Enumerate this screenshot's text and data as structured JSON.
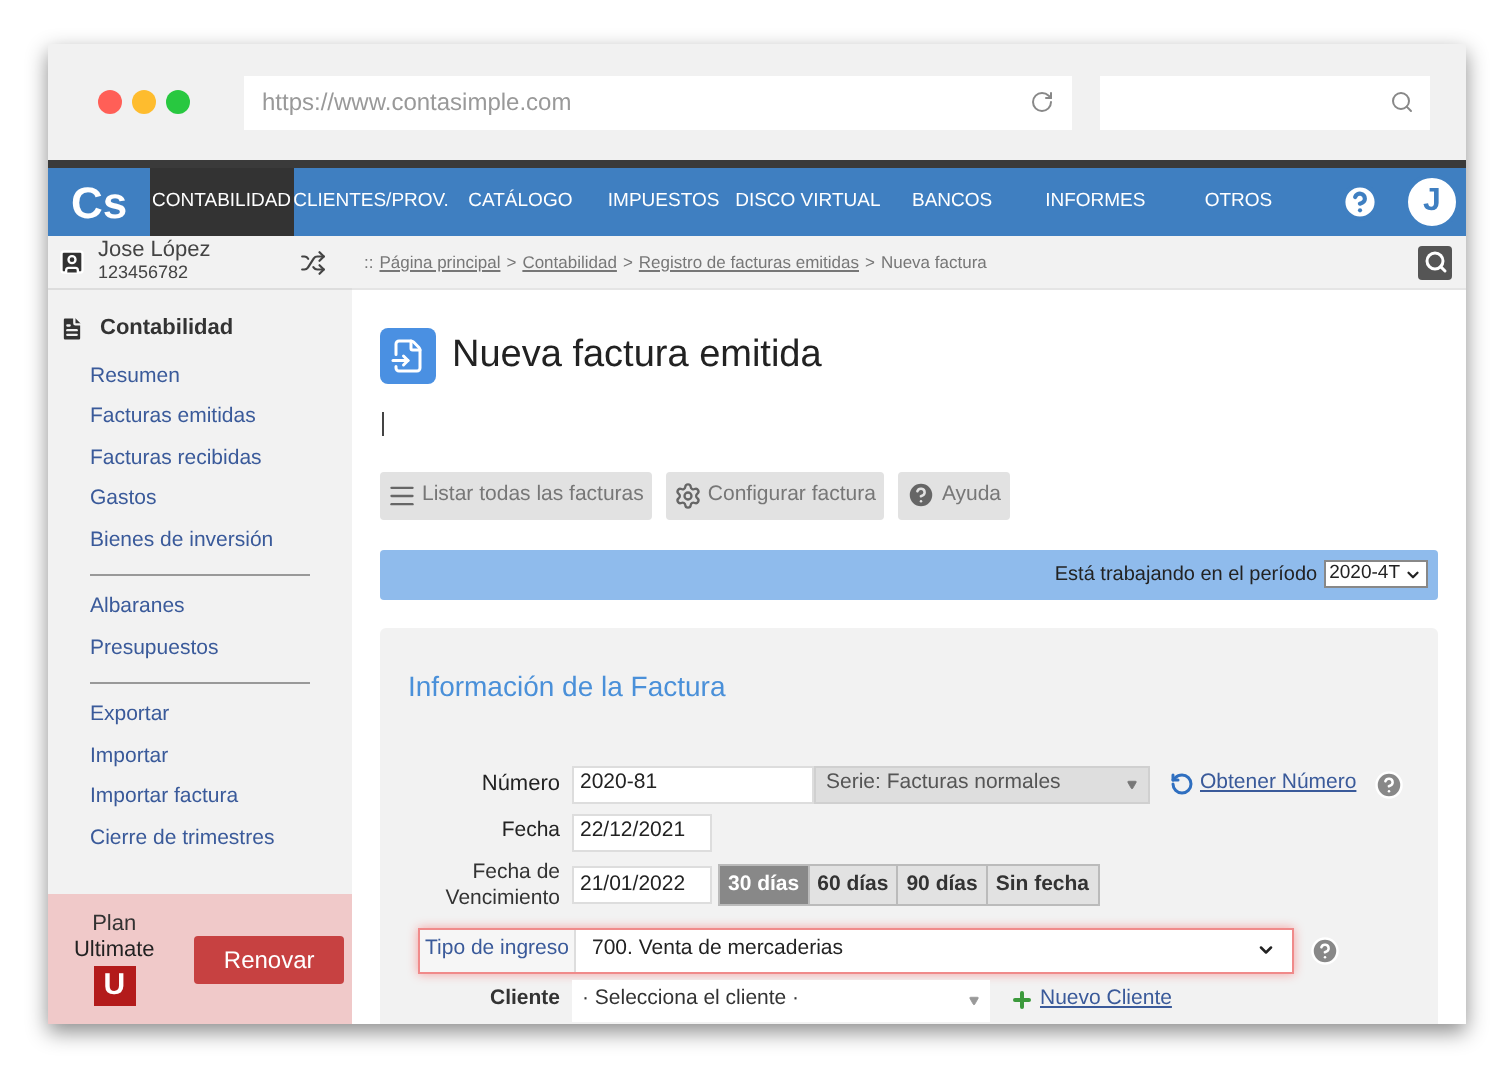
{
  "browser": {
    "url": "https://www.contasimple.com"
  },
  "nav": {
    "logo": "Cs",
    "tabs": [
      {
        "label": "CONTABILIDAD",
        "selected": true
      },
      {
        "label": "CLIENTES/PROV.",
        "selected": false
      },
      {
        "label": "CATÁLOGO",
        "selected": false
      },
      {
        "label": "IMPUESTOS",
        "selected": false
      },
      {
        "label": "DISCO VIRTUAL",
        "selected": false
      },
      {
        "label": "BANCOS",
        "selected": false
      },
      {
        "label": "INFORMES",
        "selected": false
      },
      {
        "label": "OTROS",
        "selected": false
      }
    ],
    "avatar": "J"
  },
  "user": {
    "name": "Jose López",
    "id": "123456782"
  },
  "breadcrumb": [
    {
      "kind": "sep",
      "text": "::"
    },
    {
      "kind": "link",
      "text": "Página principal"
    },
    {
      "kind": "sep",
      "text": ">"
    },
    {
      "kind": "link",
      "text": "Contabilidad"
    },
    {
      "kind": "sep",
      "text": ">"
    },
    {
      "kind": "link",
      "text": "Registro de facturas emitidas"
    },
    {
      "kind": "sep",
      "text": ">"
    },
    {
      "kind": "current",
      "text": "Nueva factura"
    }
  ],
  "sidebar": {
    "title": "Contabilidad",
    "groups": [
      [
        "Resumen",
        "Facturas emitidas",
        "Facturas recibidas",
        "Gastos",
        "Bienes de inversión"
      ],
      [
        "Albaranes",
        "Presupuestos"
      ],
      [
        "Exportar",
        "Importar",
        "Importar factura",
        "Cierre de trimestres"
      ]
    ],
    "plan": {
      "label": "Plan",
      "name": "Ultimate",
      "badge": "U",
      "button": "Renovar"
    }
  },
  "page": {
    "title": "Nueva factura emitida",
    "toolbar": [
      {
        "kind": "list",
        "label": "Listar todas las facturas"
      },
      {
        "kind": "settings",
        "label": "Configurar factura"
      },
      {
        "kind": "help",
        "label": "Ayuda"
      }
    ],
    "period": {
      "text": "Está trabajando en el período",
      "value": "2020-4T"
    }
  },
  "form": {
    "title": "Información de la Factura",
    "numero": {
      "label": "Número",
      "value": "2020-81",
      "serie": "Serie: Facturas normales",
      "link": "Obtener Número"
    },
    "fecha": {
      "label": "Fecha",
      "value": "22/12/2021"
    },
    "vencimiento": {
      "label": "Fecha de Vencimiento",
      "value": "21/01/2022",
      "options": [
        {
          "label": "30 días",
          "selected": true
        },
        {
          "label": "60 días",
          "selected": false
        },
        {
          "label": "90 días",
          "selected": false
        },
        {
          "label": "Sin fecha",
          "selected": false
        }
      ]
    },
    "tipo": {
      "label": "Tipo de ingreso",
      "value": "700. Venta de mercaderias",
      "highlighted": true
    },
    "cliente": {
      "label": "Cliente",
      "placeholder": "· Selecciona el cliente ·",
      "link": "Nuevo Cliente"
    }
  }
}
